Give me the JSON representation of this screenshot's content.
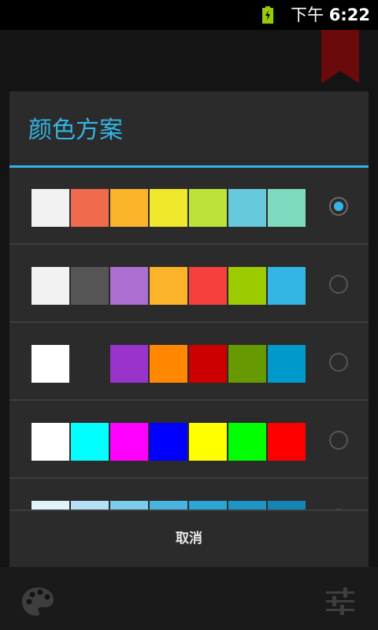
{
  "status_bar": {
    "time_prefix": "下午",
    "time_value": "6:22",
    "battery_color": "#99cc00"
  },
  "dialog": {
    "title": "颜色方案",
    "cancel_label": "取消",
    "accent": "#33b5e5",
    "schemes": [
      {
        "colors": [
          "#f2f2f2",
          "#f06a4e",
          "#fbb42a",
          "#f0e82a",
          "#bde23a",
          "#66c9dc",
          "#7edbbf"
        ],
        "selected": true
      },
      {
        "colors": [
          "#f2f2f2",
          "#555555",
          "#ac6ed0",
          "#fbb42a",
          "#f64040",
          "#9ccc00",
          "#33b5e5"
        ],
        "selected": false
      },
      {
        "colors": [
          "#ffffff",
          "#2b2b2b",
          "#9933cc",
          "#ff8800",
          "#cc0000",
          "#669900",
          "#0099cc"
        ],
        "selected": false
      },
      {
        "colors": [
          "#ffffff",
          "#00ffff",
          "#ff00ff",
          "#0000ff",
          "#ffff00",
          "#00ff00",
          "#ff0000"
        ],
        "selected": false
      },
      {
        "colors": [
          "#e3f3fb",
          "#b6e0f4",
          "#7ccbea",
          "#4ab4e0",
          "#2aa5d6",
          "#1d95c6",
          "#1485b5"
        ],
        "selected": false
      }
    ]
  },
  "icons": {
    "bookmark": "bookmark-icon",
    "palette": "palette-icon",
    "settings": "sliders-icon"
  }
}
